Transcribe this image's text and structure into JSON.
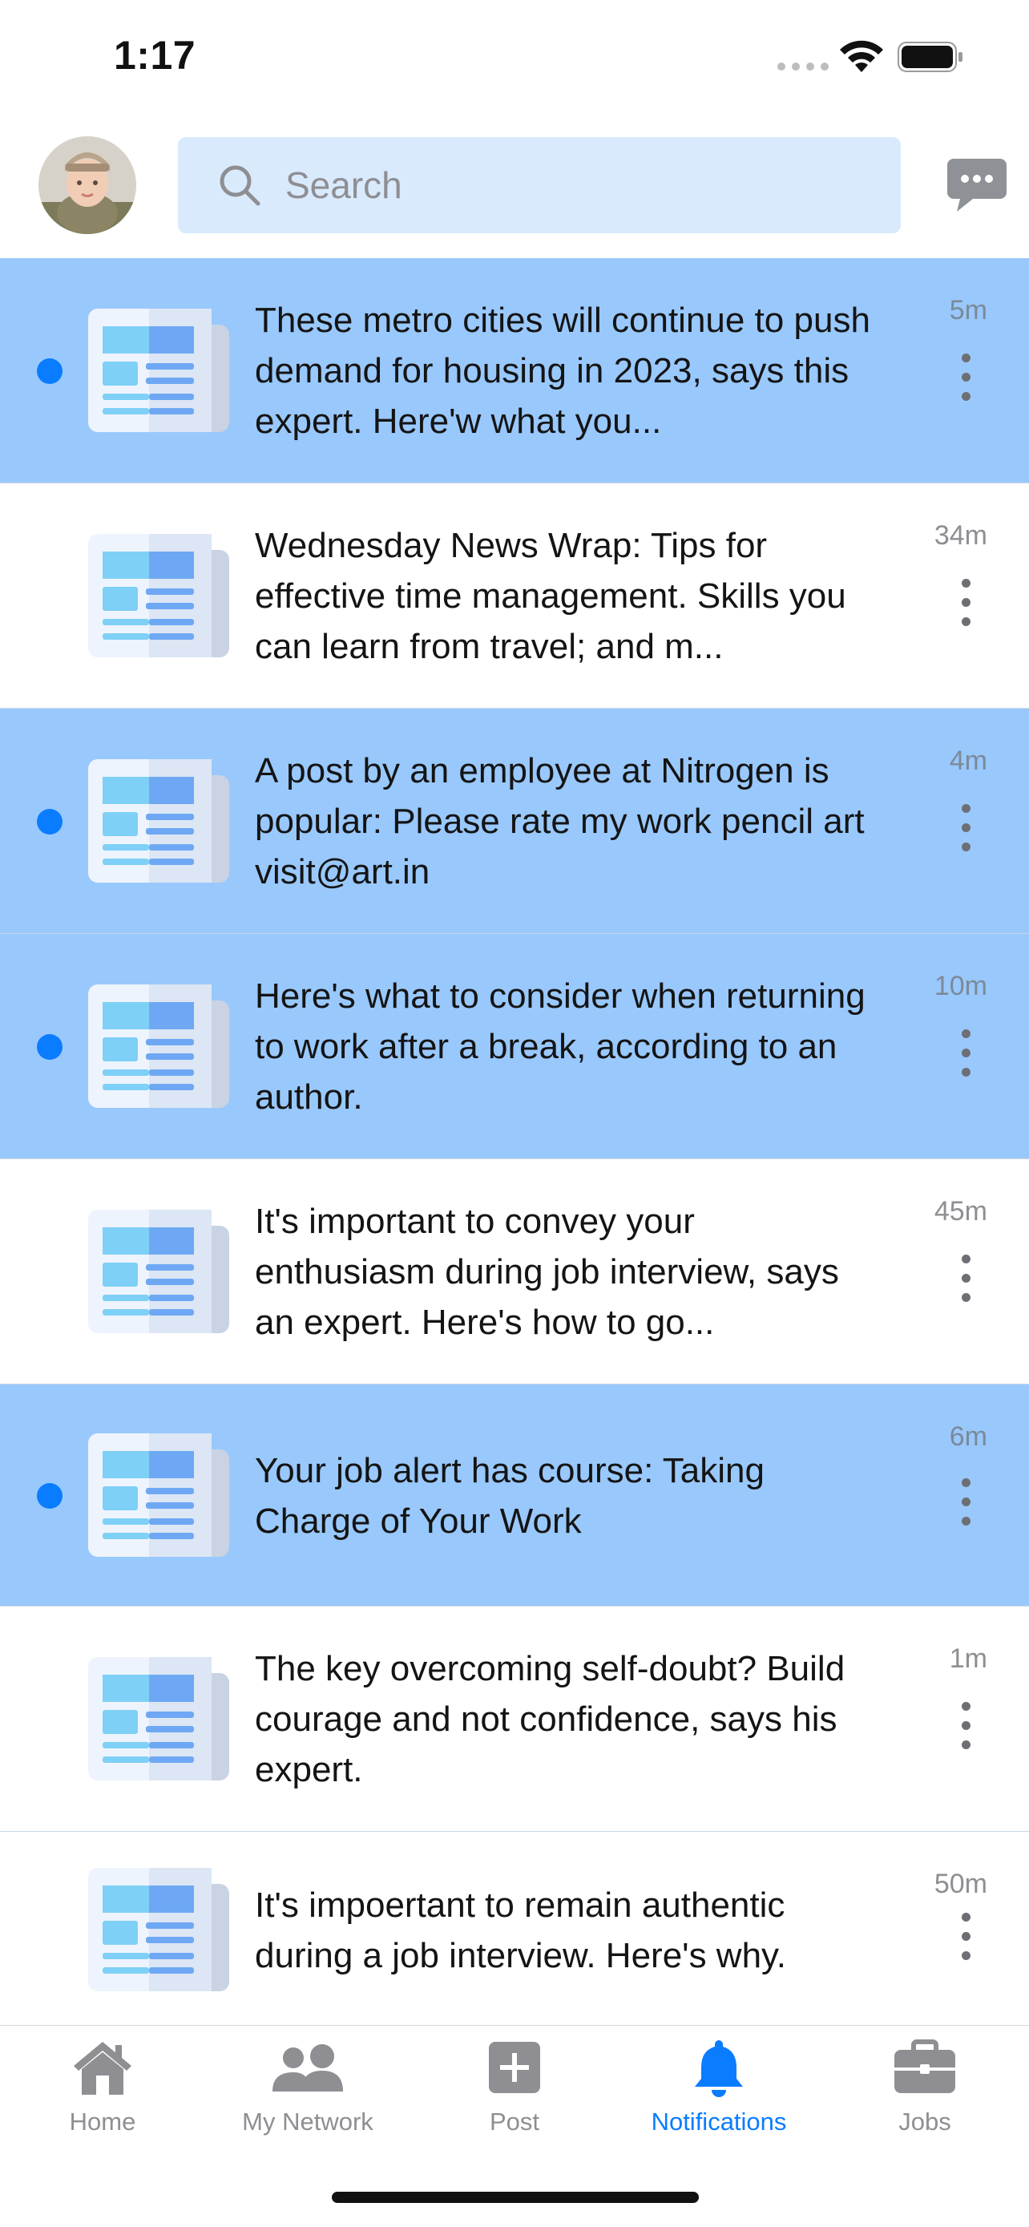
{
  "status_bar": {
    "time": "1:17"
  },
  "header": {
    "search": {
      "placeholder": "Search",
      "value": ""
    }
  },
  "notifications": [
    {
      "text": "These metro cities will continue to push demand for housing in 2023, says this expert. Here'w what you...",
      "time": "5m",
      "unread": true
    },
    {
      "text": "Wednesday News Wrap: Tips for effective time management. Skills you can learn from travel; and m...",
      "time": "34m",
      "unread": false
    },
    {
      "text": "A post by an employee at Nitrogen is popular: Please rate my work pencil art visit@art.in",
      "time": "4m",
      "unread": true
    },
    {
      "text": "Here's what to consider when returning to work after a break, according to an author.",
      "time": "10m",
      "unread": true
    },
    {
      "text": "It's important to convey your enthusiasm during job interview, says an expert. Here's how to go...",
      "time": "45m",
      "unread": false
    },
    {
      "text": "Your job alert has course: Taking Charge of Your Work",
      "time": "6m",
      "unread": true
    },
    {
      "text": "The key overcoming self-doubt? Build courage and not confidence, says his expert.",
      "time": "1m",
      "unread": false
    },
    {
      "text": "It's impoertant to remain authentic during a job interview. Here's why.",
      "time": "50m",
      "unread": false
    }
  ],
  "tab_bar": {
    "tabs": [
      {
        "label": "Home",
        "icon": "home-icon",
        "active": false
      },
      {
        "label": "My Network",
        "icon": "people-icon",
        "active": false
      },
      {
        "label": "Post",
        "icon": "plus-square-icon",
        "active": false
      },
      {
        "label": "Notifications",
        "icon": "bell-icon",
        "active": true
      },
      {
        "label": "Jobs",
        "icon": "briefcase-icon",
        "active": false
      }
    ]
  },
  "colors": {
    "unread_row": "#99c8fc",
    "unread_dot": "#0a7cff",
    "search_bg": "#d9eafd",
    "accent": "#0a7cff",
    "inactive_tab": "#8e8e93"
  }
}
